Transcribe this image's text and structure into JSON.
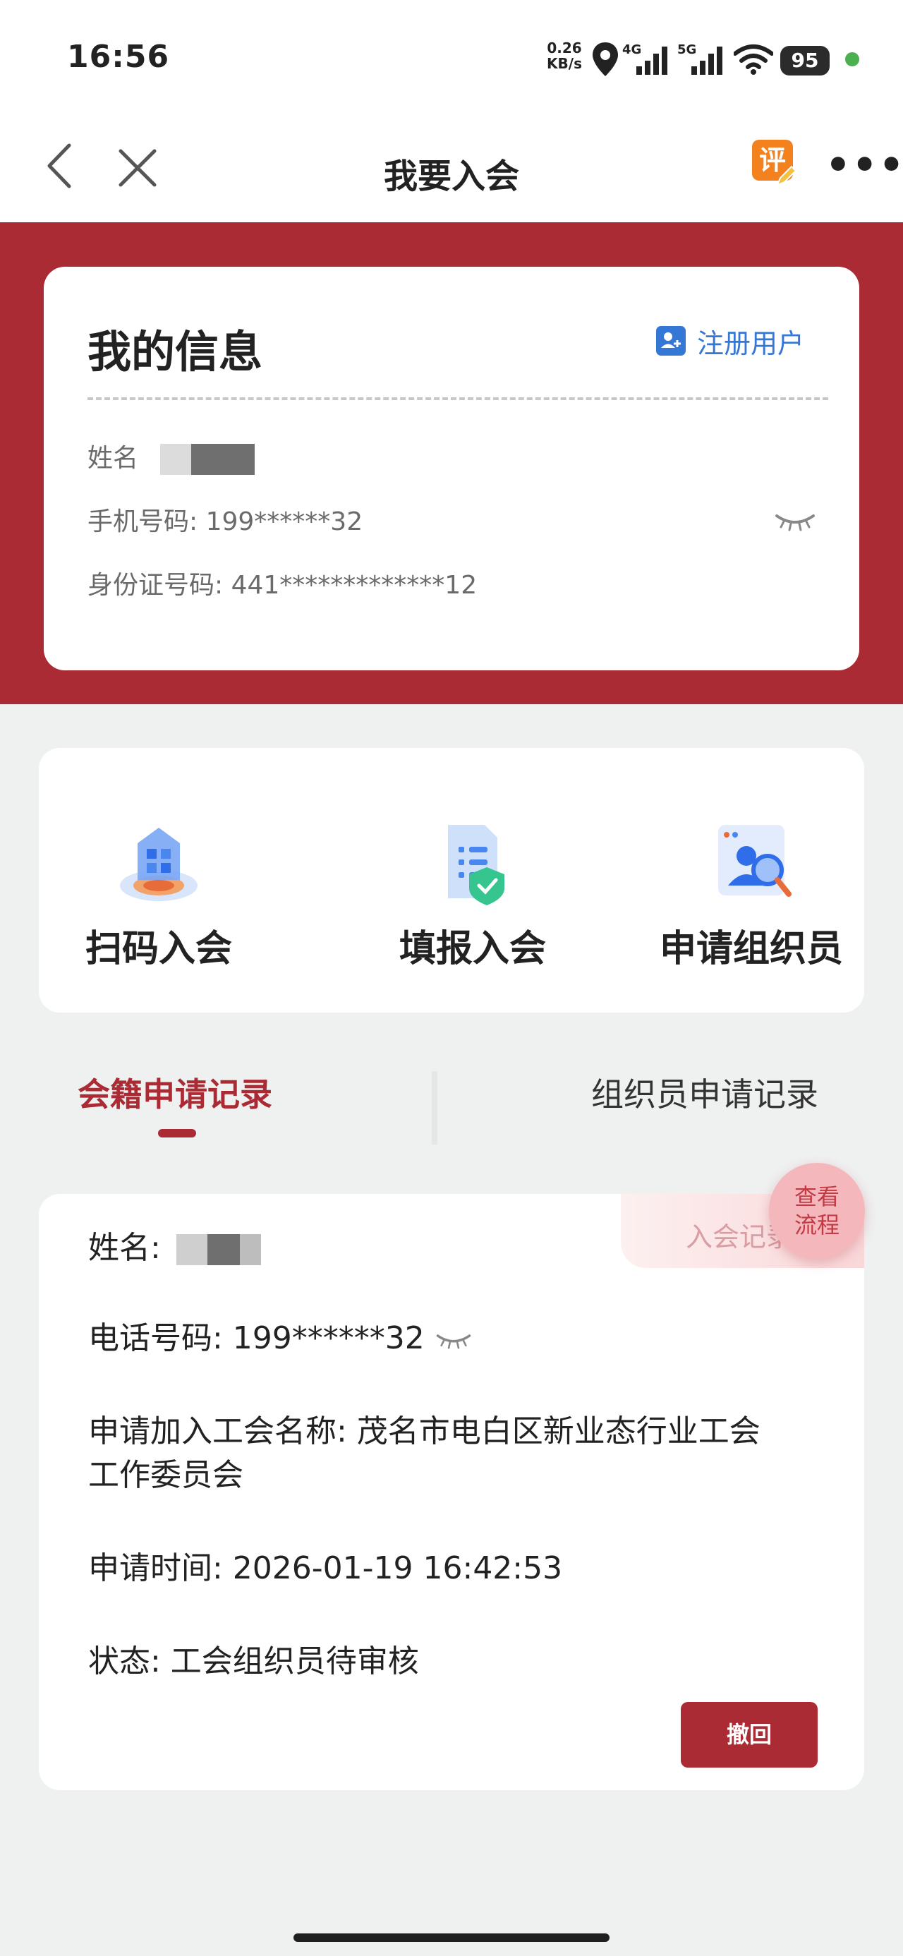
{
  "status_bar": {
    "time": "16:56",
    "net_speed_value": "0.26",
    "net_speed_unit": "KB/s",
    "signal_4g": "4G",
    "signal_5g": "5G",
    "battery": "95"
  },
  "nav": {
    "title": "我要入会",
    "eval_badge": "评"
  },
  "info_card": {
    "title": "我的信息",
    "register_label": "注册用户",
    "name_label": "姓名",
    "phone": "手机号码: 199******32",
    "id_number": "身份证号码: 441*************12"
  },
  "actions": [
    {
      "label": "扫码入会",
      "icon": "scan-join-icon"
    },
    {
      "label": "填报入会",
      "icon": "form-join-icon"
    },
    {
      "label": "申请组织员",
      "icon": "organizer-apply-icon"
    }
  ],
  "tabs": {
    "active": "会籍申请记录",
    "inactive": "组织员申请记录"
  },
  "record": {
    "name_label": "姓名:",
    "phone": "电话号码: 199******32",
    "union_line1": "申请加入工会名称: 茂名市电白区新业态行业工会",
    "union_line2": "工作委员会",
    "apply_time": "申请时间: 2026-01-19 16:42:53",
    "status": "状态: 工会组织员待审核",
    "tag": "入会记录",
    "withdraw": "撤回"
  },
  "floating": {
    "view_flow": "查看流程"
  },
  "colors": {
    "brand_red": "#ab2b34",
    "link_blue": "#3477d4",
    "background": "#eff0f0"
  }
}
